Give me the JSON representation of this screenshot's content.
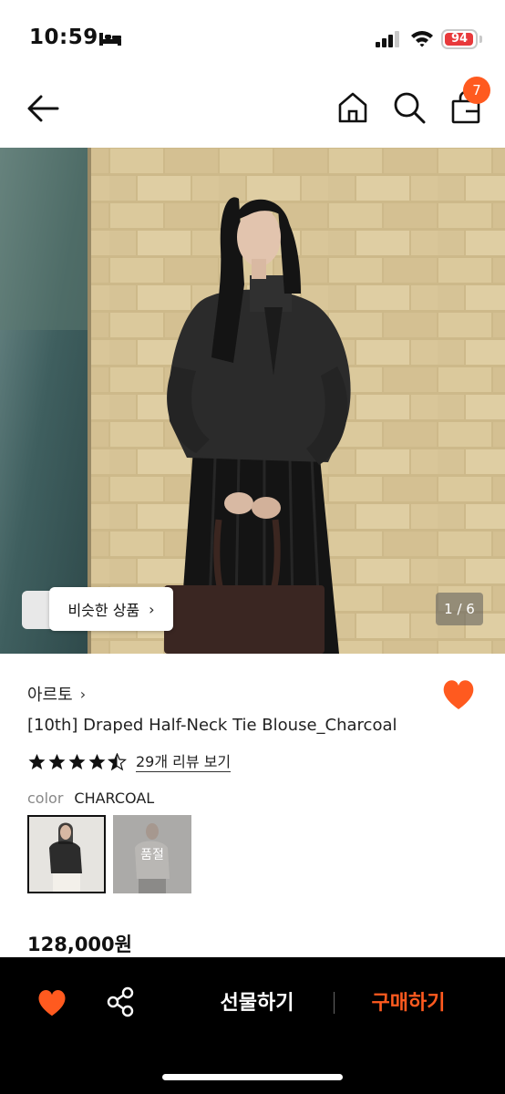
{
  "status_bar": {
    "time": "10:59",
    "battery_level": "94"
  },
  "nav": {
    "cart_count": "7"
  },
  "hero": {
    "similar_products_label": "비슷한 상품",
    "page_indicator": "1 / 6"
  },
  "product": {
    "brand": "아르토",
    "name": "[10th] Draped Half-Neck Tie Blouse_Charcoal",
    "rating": 4.5,
    "review_link": "29개 리뷰 보기",
    "option_label": "color",
    "option_value": "CHARCOAL",
    "sold_out_label": "품절",
    "price": "128,000원"
  },
  "bottom_bar": {
    "gift_label": "선물하기",
    "buy_label": "구매하기"
  },
  "colors": {
    "accent": "#ff5a1f",
    "battery": "#e8393b"
  },
  "icons": [
    "bed-icon",
    "signal-icon",
    "wifi-icon",
    "battery-icon",
    "back-arrow-icon",
    "home-icon",
    "search-icon",
    "shopping-bag-icon",
    "heart-icon",
    "share-icon",
    "star-icon",
    "chevron-right-icon"
  ]
}
